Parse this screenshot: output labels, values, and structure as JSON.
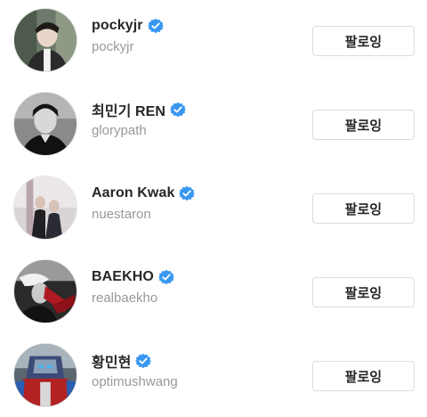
{
  "colors": {
    "verified_badge": "#3897f0",
    "name_text": "#262626",
    "handle_text": "#999999",
    "button_border": "#dbdbdb"
  },
  "users": [
    {
      "name": "pockyjr",
      "handle": "pockyjr",
      "verified": true,
      "button_label": "팔로잉"
    },
    {
      "name": "최민기 REN",
      "handle": "glorypath",
      "verified": true,
      "button_label": "팔로잉"
    },
    {
      "name": "Aaron Kwak",
      "handle": "nuestaron",
      "verified": true,
      "button_label": "팔로잉"
    },
    {
      "name": "BAEKHO",
      "handle": "realbaekho",
      "verified": true,
      "button_label": "팔로잉"
    },
    {
      "name": "황민현",
      "handle": "optimushwang",
      "verified": true,
      "button_label": "팔로잉"
    }
  ]
}
